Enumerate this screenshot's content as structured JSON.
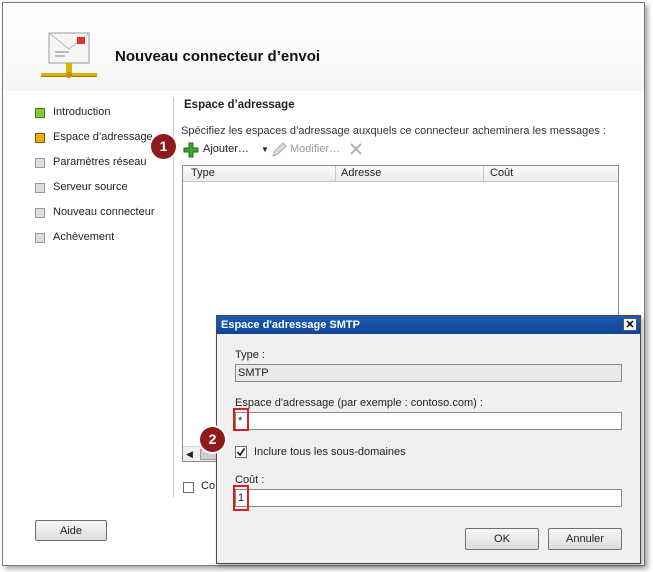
{
  "wizard": {
    "title": "Nouveau connecteur d’envoi",
    "icon": "mail-connector-icon",
    "help_button": "Aide"
  },
  "nav": {
    "items": [
      {
        "label": "Introduction",
        "state": "complete"
      },
      {
        "label": "Espace d’adressage",
        "state": "current"
      },
      {
        "label": "Paramètres réseau",
        "state": "pending"
      },
      {
        "label": "Serveur source",
        "state": "pending"
      },
      {
        "label": "Nouveau connecteur",
        "state": "pending"
      },
      {
        "label": "Achèvement",
        "state": "pending"
      }
    ]
  },
  "page": {
    "section_title": "Espace d’adressage",
    "description": "Spécifiez les espaces d’adressage auxquels ce connecteur acheminera les messages :",
    "toolbar": {
      "add_label": "Ajouter…",
      "edit_label": "Modifier…",
      "icons": [
        "add-icon",
        "dropdown-icon",
        "edit-icon",
        "delete-icon"
      ]
    },
    "grid": {
      "columns": [
        "Type",
        "Adresse",
        "Coût"
      ],
      "rows": []
    },
    "partial_checkbox_label": "Co"
  },
  "dialog": {
    "title": "Espace d'adressage SMTP",
    "type_label": "Type :",
    "type_value": "SMTP",
    "address_label": "Espace d'adressage (par exemple : contoso.com) :",
    "address_value": "*",
    "subdomains_label": "Inclure tous les sous-domaines",
    "subdomains_checked": true,
    "cost_label": "Coût :",
    "cost_value": "1",
    "ok_label": "OK",
    "cancel_label": "Annuler"
  },
  "callouts": [
    "1",
    "2"
  ],
  "colors": {
    "complete": "#8cc63f",
    "current": "#e8b100",
    "pending": "#cccccc",
    "badge": "#8e1a1a",
    "highlight": "#d42020",
    "dialog_title": "#1a5bb5"
  }
}
